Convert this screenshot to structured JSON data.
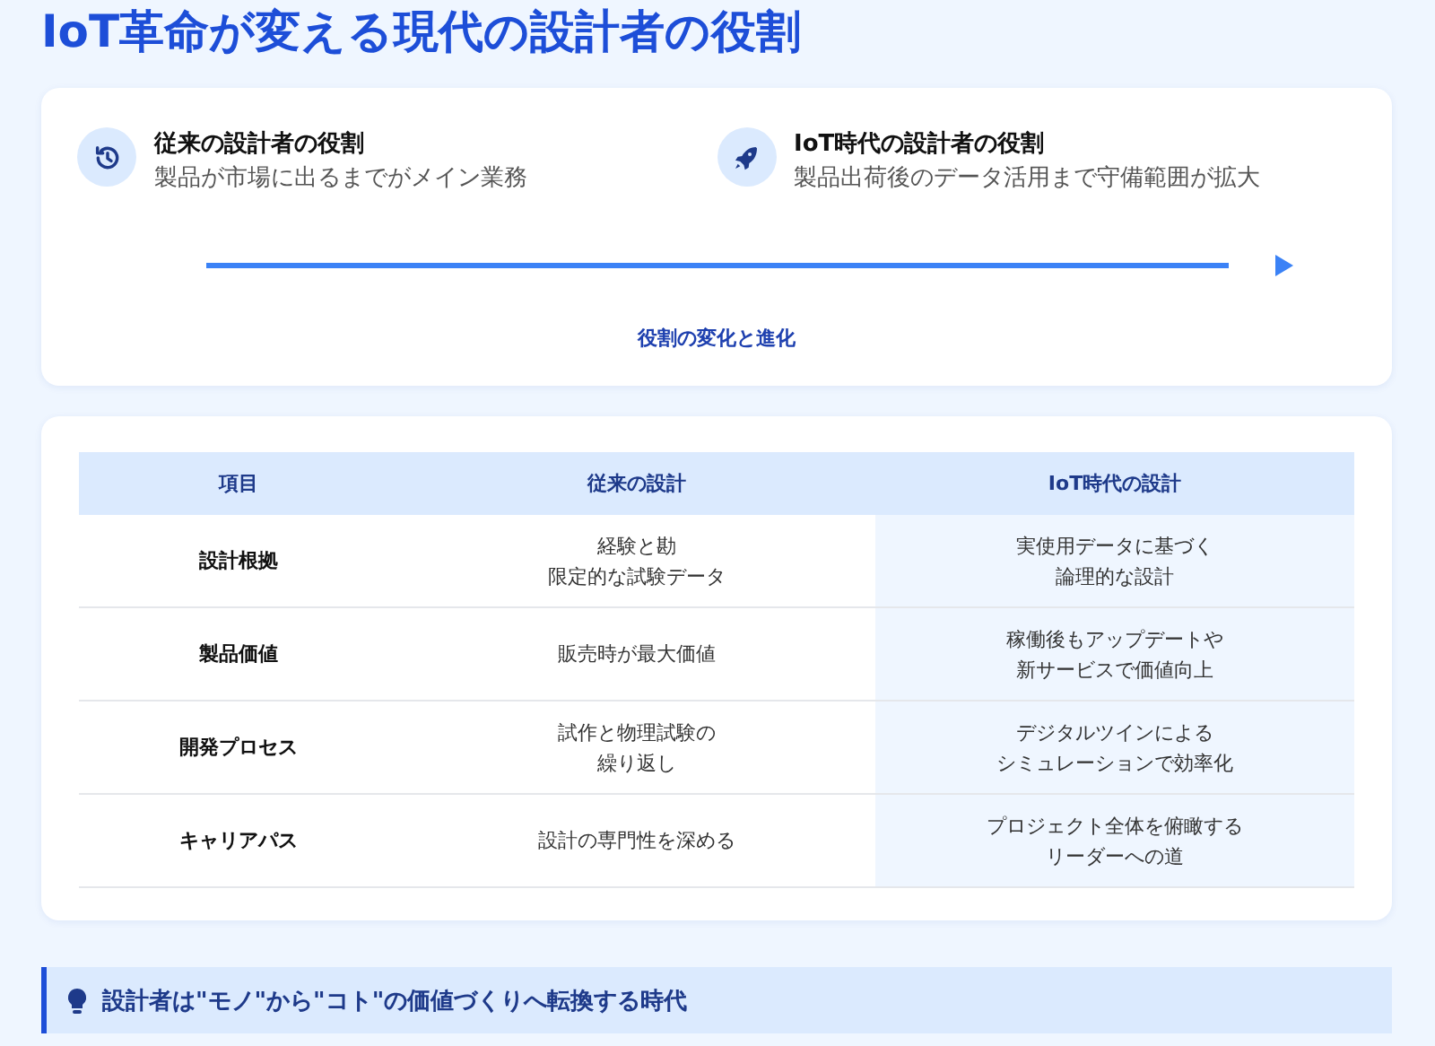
{
  "title": "IoT革命が変える現代の設計者の役割",
  "roles": [
    {
      "kind": "history",
      "title": "従来の設計者の役割",
      "description": "製品が市場に出るまでがメイン業務"
    },
    {
      "kind": "rocket",
      "title": "IoT時代の設計者の役割",
      "description": "製品出荷後のデータ活用まで守備範囲が拡大"
    }
  ],
  "transition_label": "役割の変化と進化",
  "table": {
    "columns": [
      "項目",
      "従来の設計",
      "IoT時代の設計"
    ],
    "rows": [
      [
        [
          "設計根拠"
        ],
        [
          "経験と勘",
          "限定的な試験データ"
        ],
        [
          "実使用データに基づく",
          "論理的な設計"
        ]
      ],
      [
        [
          "製品価値"
        ],
        [
          "販売時が最大価値"
        ],
        [
          "稼働後もアップデートや",
          "新サービスで価値向上"
        ]
      ],
      [
        [
          "開発プロセス"
        ],
        [
          "試作と物理試験の",
          "繰り返し"
        ],
        [
          "デジタルツインによる",
          "シミュレーションで効率化"
        ]
      ],
      [
        [
          "キャリアパス"
        ],
        [
          "設計の専門性を深める"
        ],
        [
          "プロジェクト全体を俯瞰する",
          "リーダーへの道"
        ]
      ]
    ]
  },
  "callout": "設計者は\"モノ\"から\"コト\"の価値づくりへ転換する時代"
}
